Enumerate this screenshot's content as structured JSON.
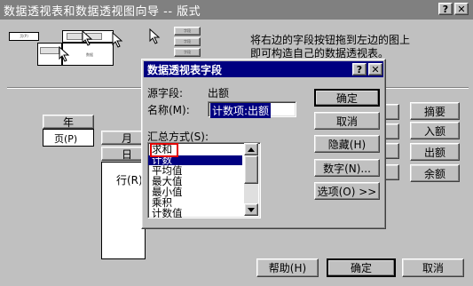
{
  "wizard": {
    "title": "数据透视表和数据透视图向导 -- 版式",
    "title_buttons": {
      "help": "?",
      "close": "✕"
    },
    "instructions": [
      "将右边的字段按钮拖到左边的图上",
      "即可构造自己的数据透视表。"
    ],
    "preview_labels": {
      "page": "页(P)",
      "col": "列",
      "row": "行",
      "data": "数据",
      "mini": "字段"
    },
    "layout": {
      "year_label": "年",
      "page_label": "页(P)",
      "month_label": "月",
      "day_label": "日",
      "row_label": "行(R)"
    },
    "field_buttons": [
      "摘要",
      "入额",
      "出额",
      "余额"
    ],
    "bottom_buttons": {
      "help": "帮助(H)",
      "ok": "确定",
      "cancel": "取消"
    }
  },
  "dialog": {
    "title": "数据透视表字段",
    "title_buttons": {
      "help": "?",
      "close": "✕"
    },
    "source_label": "源字段:",
    "source_value": "出额",
    "name_label": "名称(M):",
    "name_value": "计数项:出额",
    "summarize_label": "汇总方式(S):",
    "options": [
      "求和",
      "计数",
      "平均值",
      "最大值",
      "最小值",
      "乘积",
      "计数值"
    ],
    "selected_option": "计数",
    "buttons": {
      "ok": "确定",
      "cancel": "取消",
      "hide": "隐藏(H)",
      "number": "数字(N)...",
      "options": "选项(O) >>"
    }
  }
}
